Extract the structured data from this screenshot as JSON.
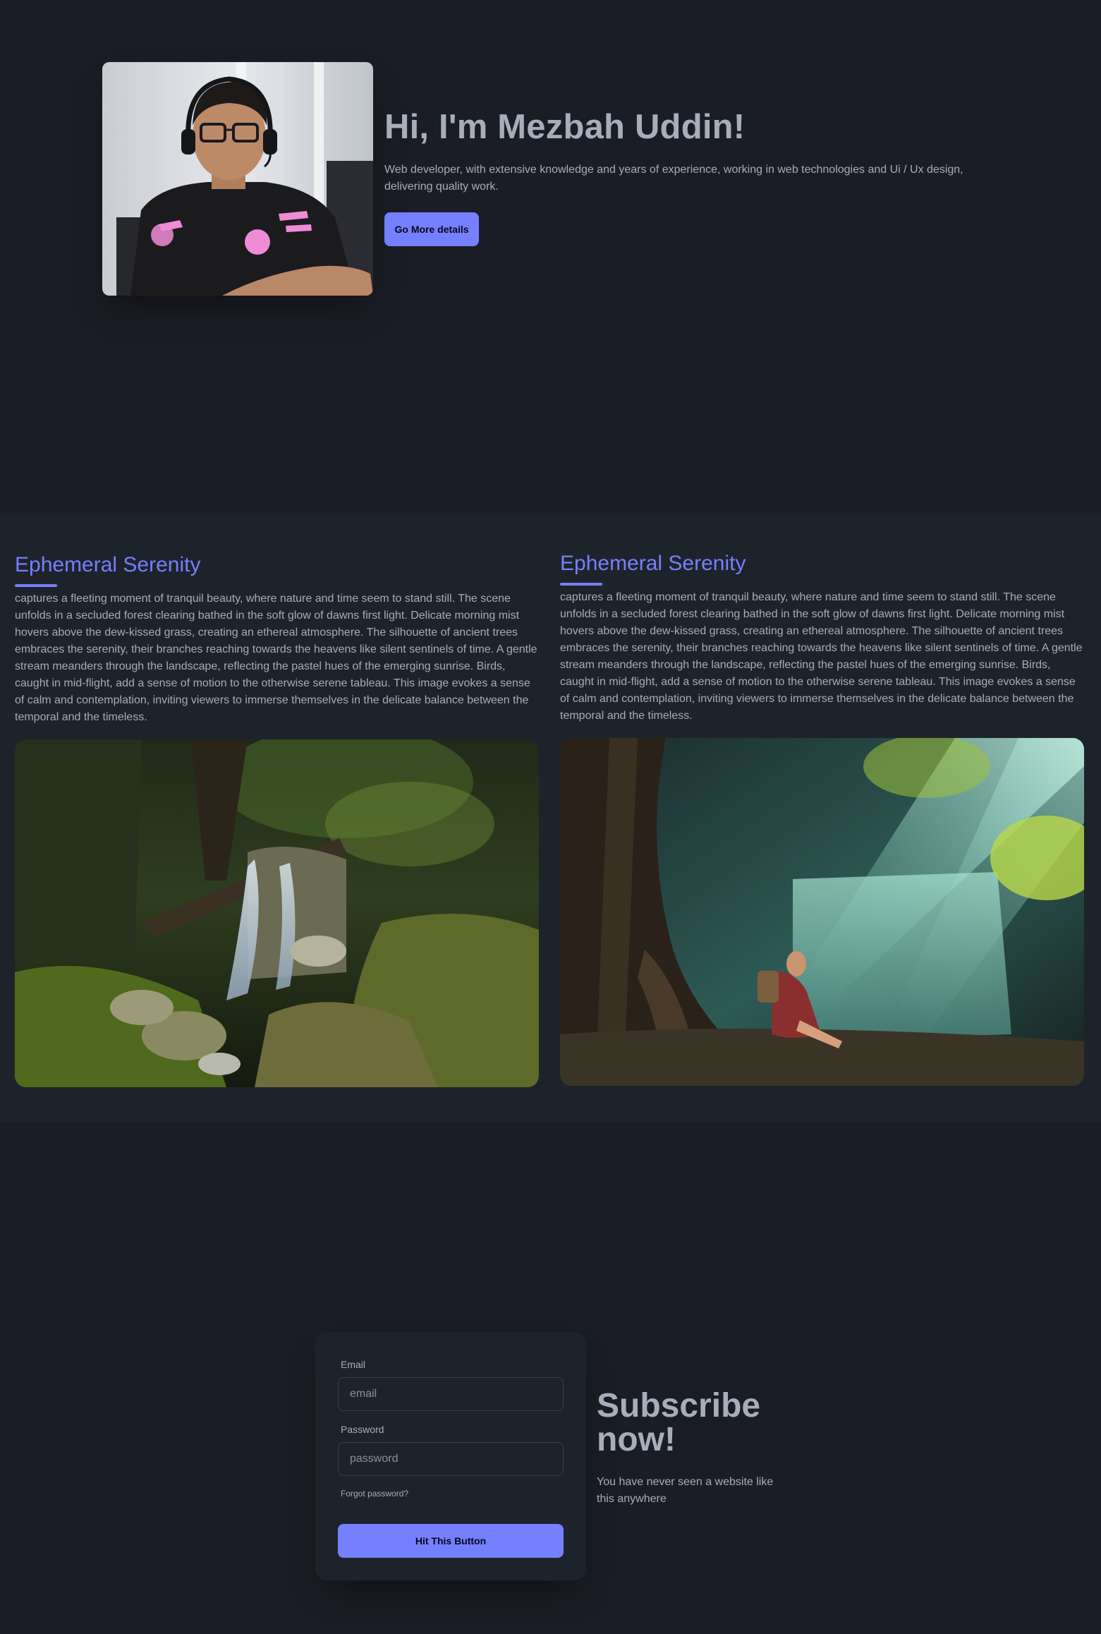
{
  "hero": {
    "photo_alt": "Portrait of Mezbah Uddin wearing a headset",
    "title": "Hi, I'm Mezbah Uddin!",
    "description": "Web developer, with extensive knowledge and years of experience, working in web technologies and Ui / Ux design, delivering quality work.",
    "button_label": "Go More details"
  },
  "articles": [
    {
      "title": "Ephemeral Serenity",
      "text": "captures a fleeting moment of tranquil beauty, where nature and time seem to stand still. The scene unfolds in a secluded forest clearing bathed in the soft glow of dawns first light. Delicate morning mist hovers above the dew-kissed grass, creating an ethereal atmosphere. The silhouette of ancient trees embraces the serenity, their branches reaching towards the heavens like silent sentinels of time. A gentle stream meanders through the landscape, reflecting the pastel hues of the emerging sunrise. Birds, caught in mid-flight, add a sense of motion to the otherwise serene tableau. This image evokes a sense of calm and contemplation, inviting viewers to immerse themselves in the delicate balance between the temporal and the timeless.",
      "image_alt": "Waterfall over mossy rocks in a forest"
    },
    {
      "title": "Ephemeral Serenity",
      "text": "captures a fleeting moment of tranquil beauty, where nature and time seem to stand still. The scene unfolds in a secluded forest clearing bathed in the soft glow of dawns first light. Delicate morning mist hovers above the dew-kissed grass, creating an ethereal atmosphere. The silhouette of ancient trees embraces the serenity, their branches reaching towards the heavens like silent sentinels of time. A gentle stream meanders through the landscape, reflecting the pastel hues of the emerging sunrise. Birds, caught in mid-flight, add a sense of motion to the otherwise serene tableau. This image evokes a sense of calm and contemplation, inviting viewers to immerse themselves in the delicate balance between the temporal and the timeless.",
      "image_alt": "Woman sitting by a sunlit waterfall"
    }
  ],
  "subscribe": {
    "email_label": "Email",
    "email_placeholder": "email",
    "password_label": "Password",
    "password_placeholder": "password",
    "forgot_label": "Forgot password?",
    "submit_label": "Hit This Button",
    "title": "Subscribe now!",
    "description": "You have never seen a website like this anywhere"
  },
  "colors": {
    "accent": "#7480ff",
    "page_bg": "#1a1d25",
    "section_bg": "#1d232a",
    "text": "#a6adbb"
  }
}
